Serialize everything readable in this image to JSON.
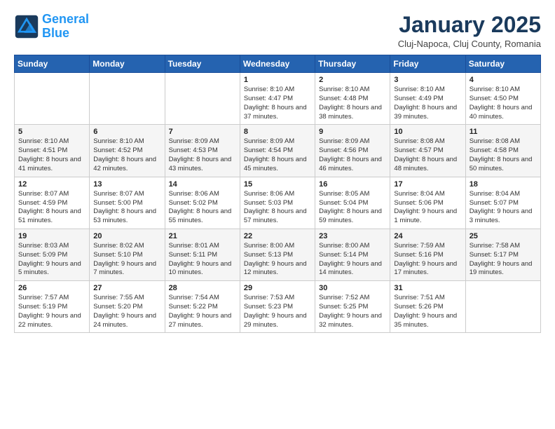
{
  "logo": {
    "line1": "General",
    "line2": "Blue"
  },
  "header": {
    "month": "January 2025",
    "location": "Cluj-Napoca, Cluj County, Romania"
  },
  "weekdays": [
    "Sunday",
    "Monday",
    "Tuesday",
    "Wednesday",
    "Thursday",
    "Friday",
    "Saturday"
  ],
  "weeks": [
    [
      {
        "day": "",
        "info": ""
      },
      {
        "day": "",
        "info": ""
      },
      {
        "day": "",
        "info": ""
      },
      {
        "day": "1",
        "info": "Sunrise: 8:10 AM\nSunset: 4:47 PM\nDaylight: 8 hours and 37 minutes."
      },
      {
        "day": "2",
        "info": "Sunrise: 8:10 AM\nSunset: 4:48 PM\nDaylight: 8 hours and 38 minutes."
      },
      {
        "day": "3",
        "info": "Sunrise: 8:10 AM\nSunset: 4:49 PM\nDaylight: 8 hours and 39 minutes."
      },
      {
        "day": "4",
        "info": "Sunrise: 8:10 AM\nSunset: 4:50 PM\nDaylight: 8 hours and 40 minutes."
      }
    ],
    [
      {
        "day": "5",
        "info": "Sunrise: 8:10 AM\nSunset: 4:51 PM\nDaylight: 8 hours and 41 minutes."
      },
      {
        "day": "6",
        "info": "Sunrise: 8:10 AM\nSunset: 4:52 PM\nDaylight: 8 hours and 42 minutes."
      },
      {
        "day": "7",
        "info": "Sunrise: 8:09 AM\nSunset: 4:53 PM\nDaylight: 8 hours and 43 minutes."
      },
      {
        "day": "8",
        "info": "Sunrise: 8:09 AM\nSunset: 4:54 PM\nDaylight: 8 hours and 45 minutes."
      },
      {
        "day": "9",
        "info": "Sunrise: 8:09 AM\nSunset: 4:56 PM\nDaylight: 8 hours and 46 minutes."
      },
      {
        "day": "10",
        "info": "Sunrise: 8:08 AM\nSunset: 4:57 PM\nDaylight: 8 hours and 48 minutes."
      },
      {
        "day": "11",
        "info": "Sunrise: 8:08 AM\nSunset: 4:58 PM\nDaylight: 8 hours and 50 minutes."
      }
    ],
    [
      {
        "day": "12",
        "info": "Sunrise: 8:07 AM\nSunset: 4:59 PM\nDaylight: 8 hours and 51 minutes."
      },
      {
        "day": "13",
        "info": "Sunrise: 8:07 AM\nSunset: 5:00 PM\nDaylight: 8 hours and 53 minutes."
      },
      {
        "day": "14",
        "info": "Sunrise: 8:06 AM\nSunset: 5:02 PM\nDaylight: 8 hours and 55 minutes."
      },
      {
        "day": "15",
        "info": "Sunrise: 8:06 AM\nSunset: 5:03 PM\nDaylight: 8 hours and 57 minutes."
      },
      {
        "day": "16",
        "info": "Sunrise: 8:05 AM\nSunset: 5:04 PM\nDaylight: 8 hours and 59 minutes."
      },
      {
        "day": "17",
        "info": "Sunrise: 8:04 AM\nSunset: 5:06 PM\nDaylight: 9 hours and 1 minute."
      },
      {
        "day": "18",
        "info": "Sunrise: 8:04 AM\nSunset: 5:07 PM\nDaylight: 9 hours and 3 minutes."
      }
    ],
    [
      {
        "day": "19",
        "info": "Sunrise: 8:03 AM\nSunset: 5:09 PM\nDaylight: 9 hours and 5 minutes."
      },
      {
        "day": "20",
        "info": "Sunrise: 8:02 AM\nSunset: 5:10 PM\nDaylight: 9 hours and 7 minutes."
      },
      {
        "day": "21",
        "info": "Sunrise: 8:01 AM\nSunset: 5:11 PM\nDaylight: 9 hours and 10 minutes."
      },
      {
        "day": "22",
        "info": "Sunrise: 8:00 AM\nSunset: 5:13 PM\nDaylight: 9 hours and 12 minutes."
      },
      {
        "day": "23",
        "info": "Sunrise: 8:00 AM\nSunset: 5:14 PM\nDaylight: 9 hours and 14 minutes."
      },
      {
        "day": "24",
        "info": "Sunrise: 7:59 AM\nSunset: 5:16 PM\nDaylight: 9 hours and 17 minutes."
      },
      {
        "day": "25",
        "info": "Sunrise: 7:58 AM\nSunset: 5:17 PM\nDaylight: 9 hours and 19 minutes."
      }
    ],
    [
      {
        "day": "26",
        "info": "Sunrise: 7:57 AM\nSunset: 5:19 PM\nDaylight: 9 hours and 22 minutes."
      },
      {
        "day": "27",
        "info": "Sunrise: 7:55 AM\nSunset: 5:20 PM\nDaylight: 9 hours and 24 minutes."
      },
      {
        "day": "28",
        "info": "Sunrise: 7:54 AM\nSunset: 5:22 PM\nDaylight: 9 hours and 27 minutes."
      },
      {
        "day": "29",
        "info": "Sunrise: 7:53 AM\nSunset: 5:23 PM\nDaylight: 9 hours and 29 minutes."
      },
      {
        "day": "30",
        "info": "Sunrise: 7:52 AM\nSunset: 5:25 PM\nDaylight: 9 hours and 32 minutes."
      },
      {
        "day": "31",
        "info": "Sunrise: 7:51 AM\nSunset: 5:26 PM\nDaylight: 9 hours and 35 minutes."
      },
      {
        "day": "",
        "info": ""
      }
    ]
  ]
}
